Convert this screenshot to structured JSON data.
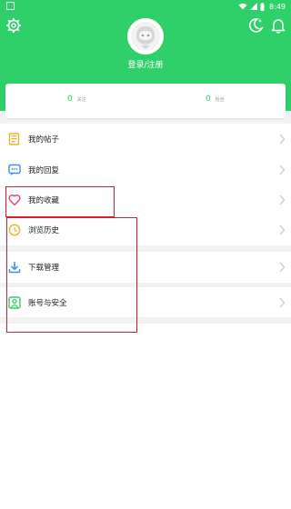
{
  "status_bar": {
    "time": "8:49"
  },
  "header": {
    "login_text": "登录/注册",
    "settings_icon": "gear-icon",
    "night_mode_icon": "moon-icon",
    "notification_icon": "bell-icon"
  },
  "stats": [
    {
      "value": "0",
      "label": "关注"
    },
    {
      "value": "0",
      "label": "粉丝"
    }
  ],
  "menu": [
    {
      "label": "我的帖子",
      "icon": "posts-icon"
    },
    {
      "label": "我的回复",
      "icon": "reply-icon"
    },
    {
      "label": "我的收藏",
      "icon": "heart-icon"
    },
    {
      "label": "浏览历史",
      "icon": "clock-icon"
    },
    {
      "label": "下载管理",
      "icon": "download-icon"
    },
    {
      "label": "账号与安全",
      "icon": "account-icon"
    }
  ],
  "colors": {
    "accent": "#2fcf6a",
    "highlight": "#d81e2b"
  }
}
